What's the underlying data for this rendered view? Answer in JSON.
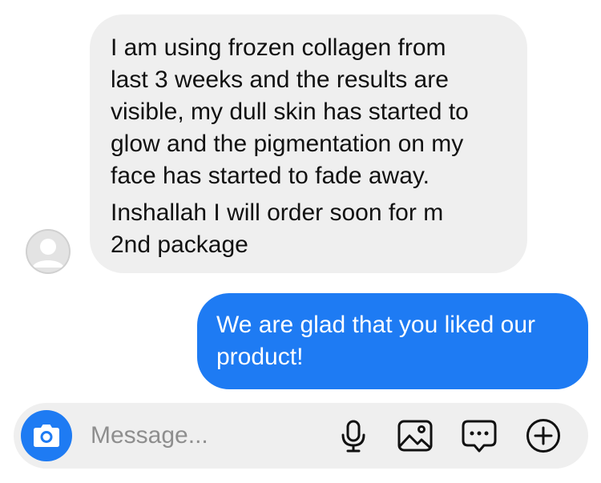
{
  "conversation": {
    "incoming": {
      "paragraph1_lines": [
        "I am using frozen collagen from",
        "last 3 weeks and the results are",
        "visible, my dull skin has started to",
        "glow and the pigmentation on my",
        "face has started to fade away."
      ],
      "paragraph2_lines": [
        "Inshallah I will order soon for m",
        "2nd package"
      ]
    },
    "outgoing": {
      "lines": [
        "We are glad that you liked our",
        "product!"
      ]
    }
  },
  "composer": {
    "placeholder": "Message...",
    "value": "",
    "icons": [
      "camera-icon",
      "microphone-icon",
      "image-icon",
      "sticker-icon",
      "plus-icon"
    ]
  },
  "colors": {
    "accent": "#1e7bf3",
    "incoming_bubble": "#efefef",
    "outgoing_text": "#ffffff",
    "placeholder": "#8e8e8e"
  }
}
